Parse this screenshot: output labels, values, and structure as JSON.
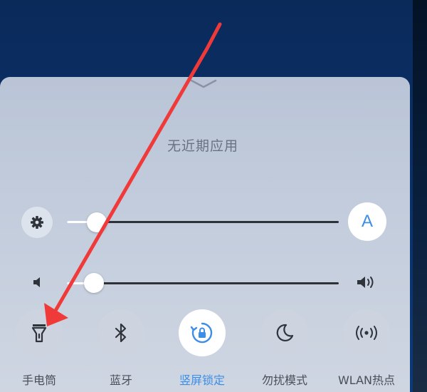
{
  "panel": {
    "recent_apps_text": "无近期应用"
  },
  "brightness": {
    "level": 0.11,
    "auto_label": "A",
    "start_icon": "gear-icon"
  },
  "volume": {
    "level": 0.1,
    "start_icon": "speaker-low-icon",
    "end_icon": "speaker-high-icon"
  },
  "toggles": [
    {
      "label": "手电筒",
      "icon": "flashlight-icon",
      "active": false
    },
    {
      "label": "蓝牙",
      "icon": "bluetooth-icon",
      "active": false
    },
    {
      "label": "竖屏锁定",
      "icon": "rotation-lock-icon",
      "active": true
    },
    {
      "label": "勿扰模式",
      "icon": "moon-icon",
      "active": false
    },
    {
      "label": "WLAN热点",
      "icon": "hotspot-icon",
      "active": false
    }
  ],
  "colors": {
    "accent": "#3d8ee6",
    "annotation_arrow": "#f03a3a"
  }
}
